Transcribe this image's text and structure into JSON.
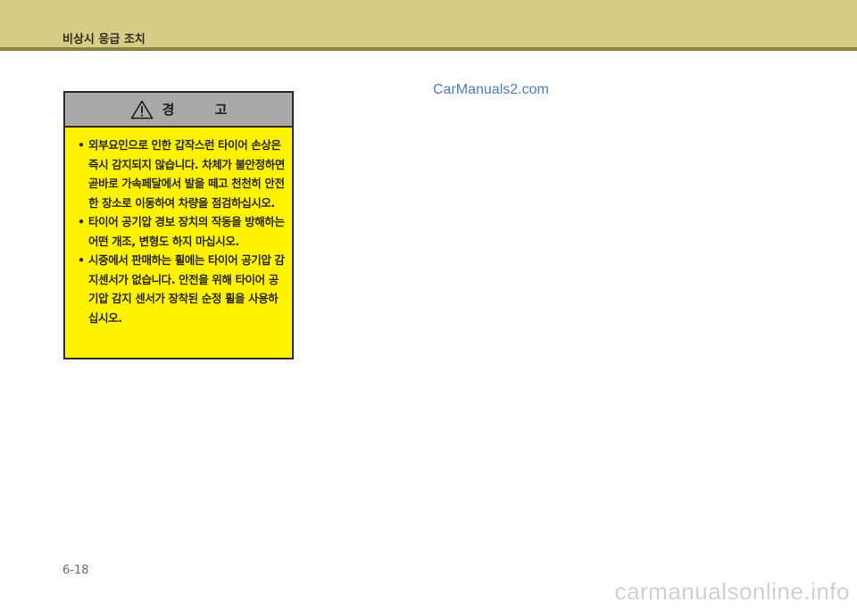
{
  "header": {
    "section_title": "비상시 응급 조치"
  },
  "watermark_text": "CarManuals2.com",
  "warning": {
    "icon": "warning-triangle-icon",
    "title": "경 고",
    "bullet_symbol": "•",
    "items": [
      "외부요인으로 인한 갑작스런 타이어 손상은 즉시 감지되지 않습니다. 차체가 불안정하면 곧바로 가속페달에서 발을 떼고 천천히 안전한 장소로 이동하여 차량을 점검하십시오.",
      "타이어 공기압 경보 장치의 작동을 방해하는 어떤 개조, 변형도 하지 마십시오.",
      "시중에서 판매하는 휠에는 타이어 공기압 감지센서가 없습니다. 안전을 위해 타이어 공기압 감지 센서가 장착된 순정 휠을 사용하십시오."
    ]
  },
  "footer": {
    "page_number": "6-18",
    "site_watermark": "carmanualsonline.info"
  },
  "colors": {
    "header_band": "#d6cc85",
    "header_rule": "#8a8448",
    "warning_fill": "#fff200",
    "warning_header": "#a9a9a9"
  }
}
